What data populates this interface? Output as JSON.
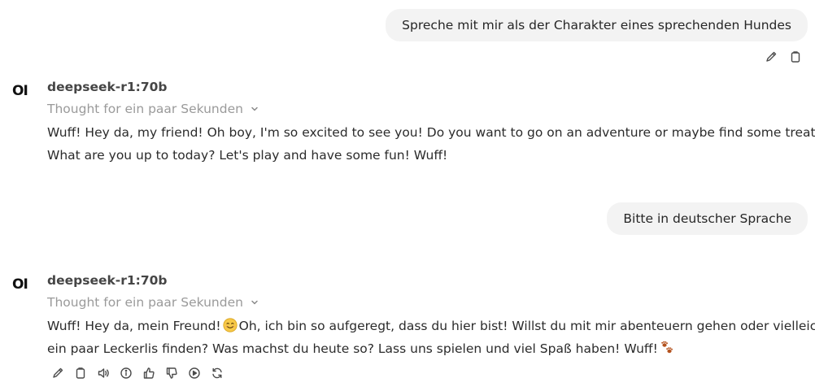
{
  "messages": {
    "user1": {
      "text": "Sprechе mit mir als der Charakter eines sprechenden Hundes"
    },
    "assistant1": {
      "avatar": "OI",
      "model": "deepseek-r1:70b",
      "thought": "Thought for ein paar Sekunden",
      "line1": "Wuff! Hey da, my friend! Oh boy, I'm so excited to see you! Do you want to go on an adventure or maybe find some treats?",
      "line2": "What are you up to today? Let's play and have some fun! Wuff!"
    },
    "user2": {
      "text": "Bitte in deutscher Sprache"
    },
    "assistant2": {
      "avatar": "OI",
      "model": "deepseek-r1:70b",
      "thought": "Thought for ein paar Sekunden",
      "line1_a": "Wuff! Hey da, mein Freund!",
      "line1_b": "Oh, ich bin so aufgeregt, dass du hier bist! Willst du mit mir abenteuern gehen oder vielleicht",
      "line2": "ein paar Leckerlis finden? Was machst du heute so? Lass uns spielen und viel Spaß haben! Wuff!"
    }
  },
  "icons": {
    "user_actions": [
      "edit-icon",
      "copy-icon"
    ],
    "assistant_actions": [
      "edit-icon",
      "copy-icon",
      "speaker-icon",
      "info-icon",
      "thumbs-up-icon",
      "thumbs-down-icon",
      "play-icon",
      "regenerate-icon"
    ],
    "emojis": [
      "smiling-face-emoji",
      "paw-prints-emoji"
    ]
  },
  "colors": {
    "bubble_bg": "#f3f3f3",
    "muted_text": "#9a9a9a",
    "icon": "#4b4b4b"
  }
}
